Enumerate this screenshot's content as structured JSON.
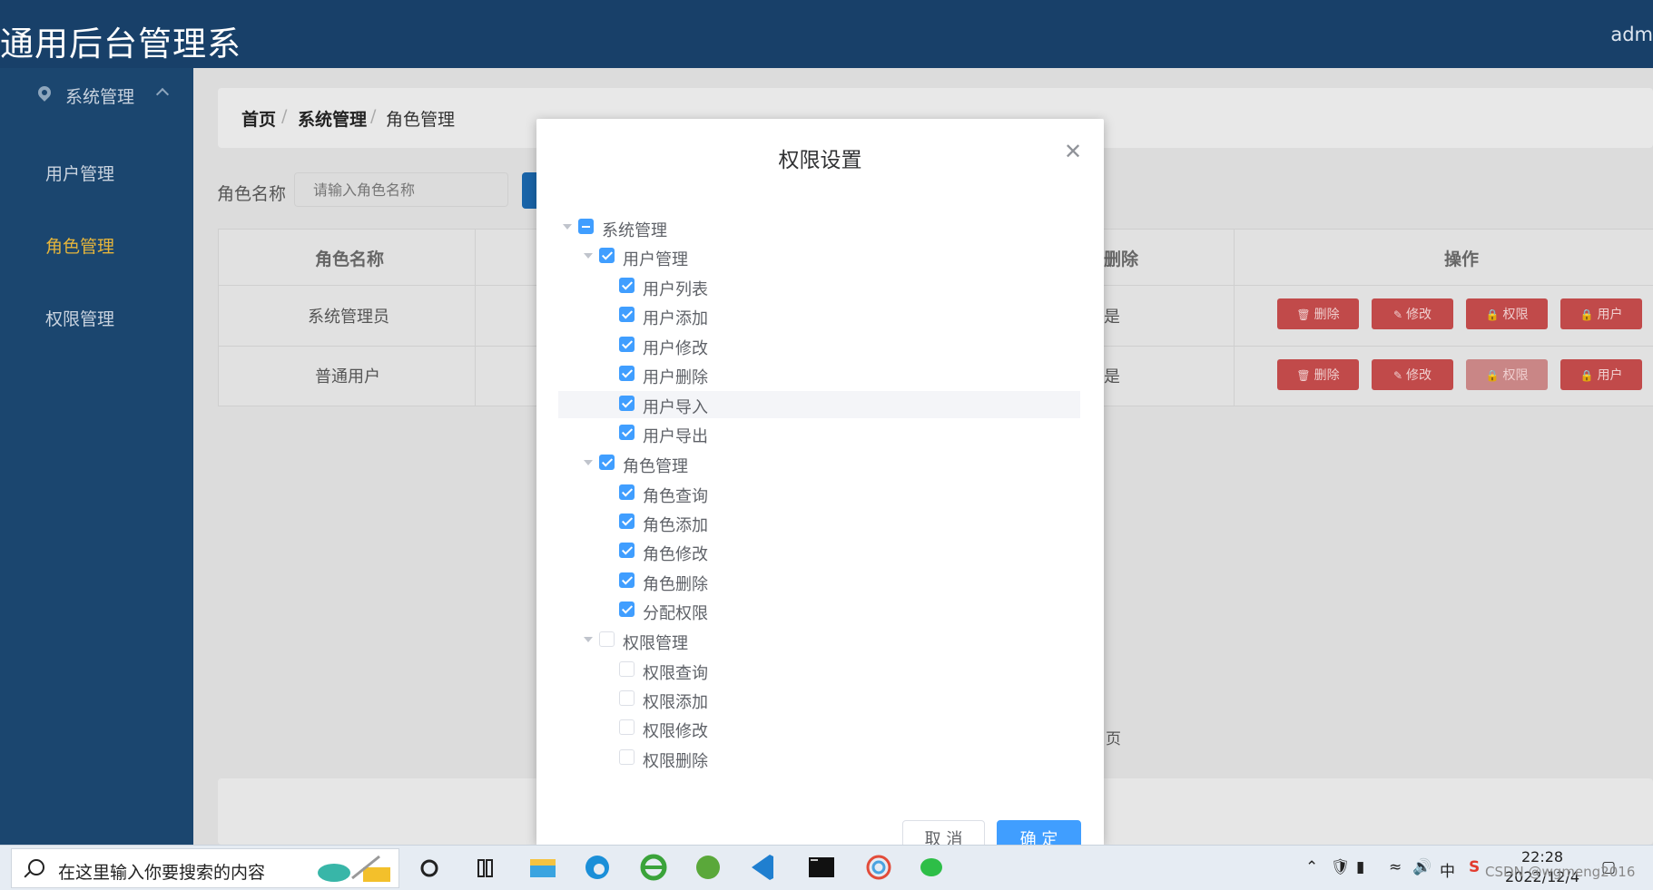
{
  "app": {
    "title": "通用后台管理系",
    "user": "adm"
  },
  "sidebar": {
    "group": "系统管理",
    "items": [
      {
        "label": "用户管理",
        "active": false
      },
      {
        "label": "角色管理",
        "active": true
      },
      {
        "label": "权限管理",
        "active": false
      }
    ]
  },
  "breadcrumb": [
    "首页",
    "系统管理",
    "角色管理"
  ],
  "search": {
    "label": "角色名称",
    "placeholder": "请输入角色名称"
  },
  "table": {
    "columns": [
      "角色名称",
      "删除",
      "操作"
    ],
    "rows": [
      {
        "name": "系统管理员",
        "deleted": "是"
      },
      {
        "name": "普通用户",
        "deleted": "是"
      }
    ],
    "actions": [
      "删除",
      "修改",
      "权限",
      "用户"
    ]
  },
  "pager_text": "页",
  "dialog": {
    "title": "权限设置",
    "cancel_label": "取 消",
    "ok_label": "确 定",
    "tree": {
      "root": {
        "label": "系统管理",
        "state": "indeterminate"
      },
      "user_mgmt": {
        "label": "用户管理",
        "state": "checked",
        "children": [
          "用户列表",
          "用户添加",
          "用户修改",
          "用户删除",
          "用户导入",
          "用户导出"
        ]
      },
      "role_mgmt": {
        "label": "角色管理",
        "state": "checked",
        "children": [
          "角色查询",
          "角色添加",
          "角色修改",
          "角色删除",
          "分配权限"
        ]
      },
      "perm_mgmt": {
        "label": "权限管理",
        "state": "unchecked",
        "children": [
          "权限查询",
          "权限添加",
          "权限修改",
          "权限删除"
        ]
      }
    }
  },
  "taskbar": {
    "search_placeholder": "在这里输入你要搜索的内容",
    "ime": "中",
    "time": "22:28",
    "date": "2022/12/4",
    "watermark": "CSDN @wgmeng2016"
  },
  "colors": {
    "header": "#184069",
    "sidebar": "#1b466f",
    "accent": "#e6b53b",
    "primary": "#409eff",
    "danger": "#c14a4a"
  }
}
